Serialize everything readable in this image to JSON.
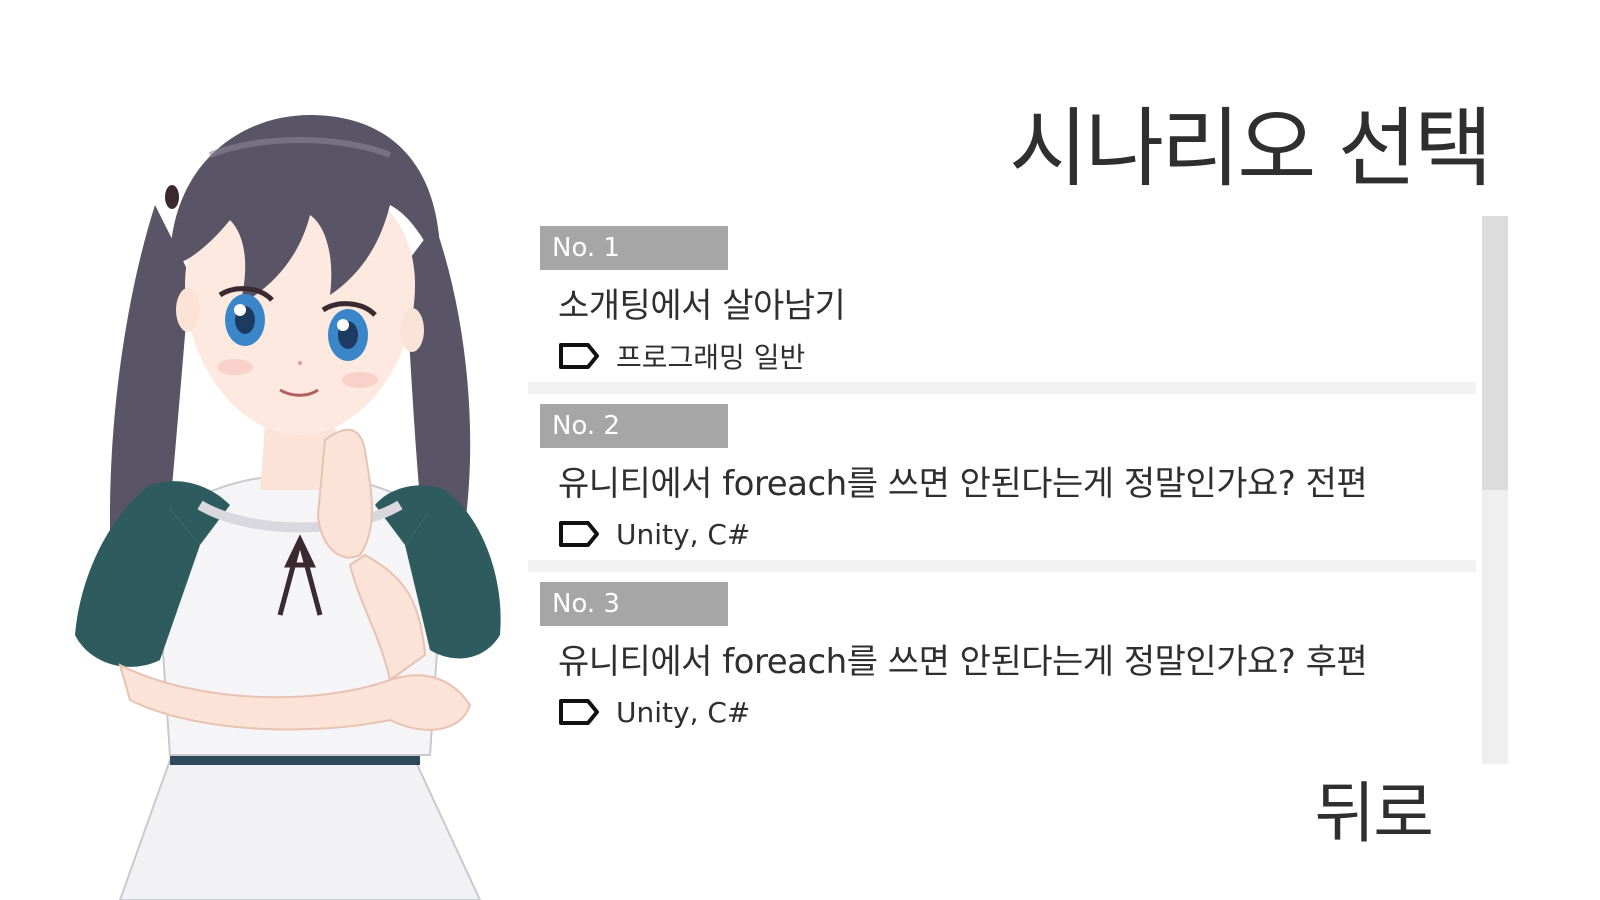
{
  "screen": {
    "title": "시나리오 선택",
    "back_label": "뒤로"
  },
  "scenarios": [
    {
      "number": "No. 1",
      "title": "소개팅에서 살아남기",
      "tag": "프로그래밍 일반"
    },
    {
      "number": "No. 2",
      "title": "유니티에서 foreach를 쓰면 안된다는게 정말인가요?  전편",
      "tag": "Unity, C#"
    },
    {
      "number": "No. 3",
      "title": "유니티에서 foreach를 쓰면 안된다는게 정말인가요?  후편",
      "tag": "Unity, C#"
    }
  ],
  "icons": {
    "tag": "tag-icon",
    "character": "character-illustration"
  },
  "colors": {
    "background": "#ffffff",
    "text": "#2f2f2f",
    "number_badge": "#a6a6a6",
    "divider": "#f2f2f2",
    "scroll_track": "#efefef",
    "scroll_thumb": "#dcdcdc",
    "hair": "#5a5566",
    "dress": "#2e5c5e"
  },
  "scroll": {
    "position_fraction": 0.0,
    "visible_fraction": 0.5
  }
}
